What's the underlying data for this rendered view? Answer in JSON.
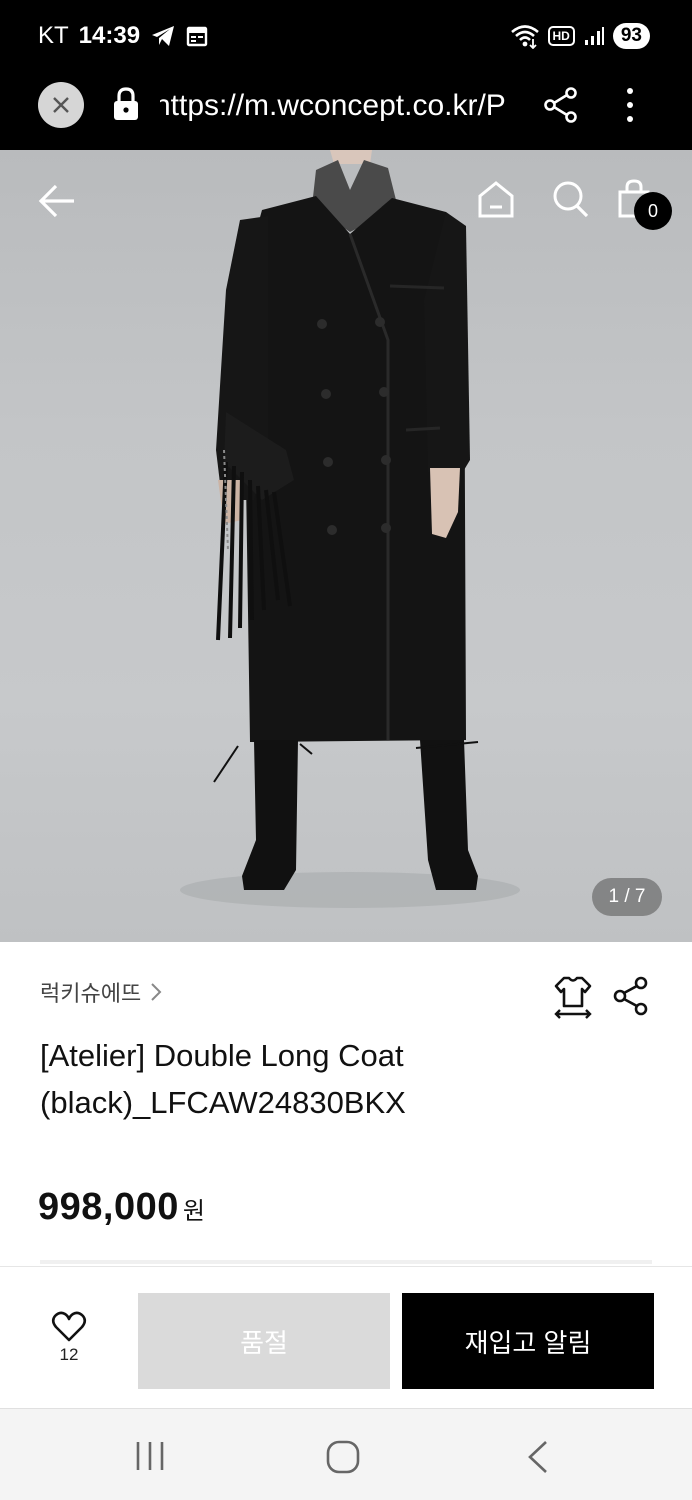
{
  "status_bar": {
    "carrier": "KT",
    "time": "14:39",
    "hd": "HD",
    "battery": "93"
  },
  "browser": {
    "url": "https://m.wconcept.co.kr/P"
  },
  "product": {
    "brand": "럭키슈에뜨",
    "title_line1": "[Atelier] Double Long Coat",
    "title_line2": "(black)_LFCAW24830BKX",
    "price": "998,000",
    "currency": "원",
    "image_counter": "1 / 7",
    "cart_count": "0"
  },
  "actions": {
    "wish_count": "12",
    "soldout_label": "품절",
    "restock_label": "재입고 알림"
  },
  "icons": {
    "status_left": [
      "telegram-icon",
      "calendar-icon"
    ],
    "status_right": [
      "wifi-icon",
      "hd-icon",
      "signal-icon",
      "battery-icon"
    ],
    "url_bar": [
      "close-icon",
      "lock-icon",
      "share-icon",
      "more-vert-icon"
    ],
    "header": [
      "back-arrow-icon",
      "home-icon",
      "search-icon",
      "shopping-bag-icon"
    ],
    "product": [
      "chevron-right-icon",
      "size-guide-icon",
      "share-icon"
    ],
    "action": [
      "heart-icon"
    ],
    "nav": [
      "recent-apps-icon",
      "home-circle-icon",
      "back-chevron-icon"
    ]
  },
  "colors": {
    "status_bg": "#000000",
    "primary_button": "#000000",
    "soldout_button": "#dadada"
  }
}
